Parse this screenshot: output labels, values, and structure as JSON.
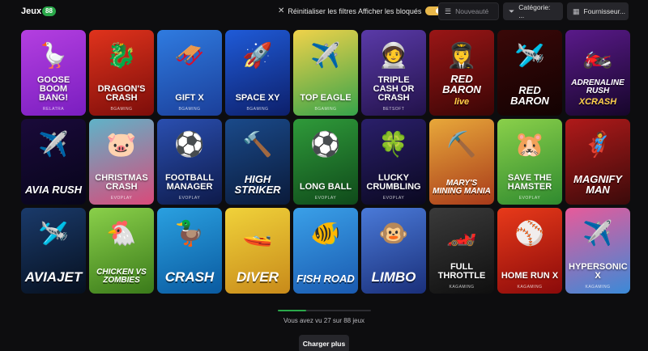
{
  "header": {
    "title": "Jeux",
    "count": "88",
    "reset_label": "Réinitialiser les filtres",
    "blocked_label": "Afficher les bloqués",
    "sort_placeholder": "Nouveauté",
    "category_label": "Catégorie: ...",
    "providers_label": "Fournisseur..."
  },
  "colors": {
    "accent_green": "#2aa84a",
    "toggle_on": "#e8b74a",
    "background": "#0d0d0f"
  },
  "games": [
    {
      "name": "GOOSE BOOM BANG!",
      "provider": "RELATRA",
      "bg": "linear-gradient(160deg,#b43fe0,#7a1ec0)",
      "icon": "🪿"
    },
    {
      "name": "DRAGON'S CRASH",
      "provider": "BGAMING",
      "bg": "linear-gradient(160deg,#e0331c,#7c0d0a)",
      "icon": "🐉"
    },
    {
      "name": "GIFT X",
      "provider": "BGAMING",
      "bg": "linear-gradient(160deg,#2f7be0,#1b3f9a)",
      "icon": "🛷"
    },
    {
      "name": "SPACE XY",
      "provider": "BGAMING",
      "bg": "linear-gradient(160deg,#1f5bd8,#0d1f6a)",
      "icon": "🚀"
    },
    {
      "name": "TOP EAGLE",
      "provider": "BGAMING",
      "bg": "linear-gradient(160deg,#f0d24a,#36a34a)",
      "icon": "✈️"
    },
    {
      "name": "TRIPLE CASH OR CRASH",
      "provider": "BETSOFT",
      "bg": "linear-gradient(160deg,#5a3aa8,#22124a)",
      "icon": "🧑‍🚀"
    },
    {
      "name": "RED BARON",
      "provider": "",
      "bg": "linear-gradient(160deg,#9a1616,#3a0505)",
      "icon": "👩‍✈️",
      "logo": "RED BARON",
      "logo_sub": "live"
    },
    {
      "name": "RED BARON",
      "provider": "",
      "bg": "linear-gradient(160deg,#3a0808,#120202)",
      "icon": "🛩️",
      "logo": "RED BARON"
    },
    {
      "name": "ADRENALINE RUSH XCRASH",
      "provider": "",
      "bg": "linear-gradient(160deg,#5a1a8a,#16062a)",
      "icon": "🏍️",
      "logo": "ADRENALINE RUSH",
      "logo_sub": "XCRASH"
    },
    {
      "name": "AVIA RUSH",
      "provider": "",
      "bg": "linear-gradient(160deg,#1a0a3a,#07051a)",
      "icon": "✈️",
      "logo": "AVIA RUSH"
    },
    {
      "name": "CHRISTMAS CRASH",
      "provider": "EVOPLAY",
      "bg": "linear-gradient(160deg,#5fb3c8,#d94a7a)",
      "icon": "🐷"
    },
    {
      "name": "FOOTBALL MANAGER",
      "provider": "EVOPLAY",
      "bg": "linear-gradient(160deg,#2a4fb0,#0e1a4a)",
      "icon": "⚽"
    },
    {
      "name": "HIGH STRIKER",
      "provider": "",
      "bg": "linear-gradient(160deg,#1a4a8a,#0a1a3a)",
      "icon": "🔨",
      "logo": "HIGH STRIKER"
    },
    {
      "name": "LONG BALL",
      "provider": "EVOPLAY",
      "bg": "linear-gradient(160deg,#2f9a3a,#0f4a1a)",
      "icon": "⚽"
    },
    {
      "name": "LUCKY CRUMBLING",
      "provider": "EVOPLAY",
      "bg": "linear-gradient(160deg,#2a1f6a,#0a0820)",
      "icon": "🍀"
    },
    {
      "name": "MARY'S MINING MANIA",
      "provider": "",
      "bg": "linear-gradient(160deg,#e8a83a,#a83a1a)",
      "icon": "⛏️",
      "logo": "MARY'S MINING MANIA"
    },
    {
      "name": "SAVE THE HAMSTER",
      "provider": "EVOPLAY",
      "bg": "linear-gradient(160deg,#8ad04a,#2f8a2f)",
      "icon": "🐹"
    },
    {
      "name": "MAGNIFY MAN",
      "provider": "",
      "bg": "linear-gradient(160deg,#b01a1a,#3a0a0a)",
      "icon": "🦸",
      "logo": "MAGNIFY MAN"
    },
    {
      "name": "AVIAJET",
      "provider": "",
      "bg": "linear-gradient(160deg,#1a3a6a,#06101f)",
      "icon": "🛩️",
      "logo": "AVIAJET"
    },
    {
      "name": "CHICKEN VS ZOMBIES",
      "provider": "",
      "bg": "linear-gradient(160deg,#8ad04a,#3a7a1a)",
      "icon": "🐔",
      "logo": "CHICKEN VS ZOMBIES"
    },
    {
      "name": "CRASH",
      "provider": "",
      "bg": "linear-gradient(160deg,#2aa0e0,#0a5aa0)",
      "icon": "🦆",
      "logo": "CRASH"
    },
    {
      "name": "DIVER",
      "provider": "",
      "bg": "linear-gradient(160deg,#f0d23a,#c88a1a)",
      "icon": "🚤",
      "logo": "DIVER"
    },
    {
      "name": "FISH ROAD",
      "provider": "",
      "bg": "linear-gradient(160deg,#3aa0e8,#1a5ab0)",
      "icon": "🐠",
      "logo": "FISH ROAD"
    },
    {
      "name": "LIMBO",
      "provider": "",
      "bg": "linear-gradient(160deg,#4a7ad8,#1a2f7a)",
      "icon": "🐵",
      "logo": "LIMBO"
    },
    {
      "name": "FULL THROTTLE",
      "provider": "KAGAMING",
      "bg": "linear-gradient(160deg,#3a3a3a,#0f0f0f)",
      "icon": "🏎️"
    },
    {
      "name": "HOME RUN X",
      "provider": "KAGAMING",
      "bg": "linear-gradient(160deg,#e83a1a,#8a0a0a)",
      "icon": "⚾"
    },
    {
      "name": "HYPERSONIC X",
      "provider": "KAGAMING",
      "bg": "linear-gradient(160deg,#e85a9a,#3a8ad8)",
      "icon": "✈️"
    }
  ],
  "footer": {
    "progress": 0.307,
    "seen_text": "Vous avez vu 27 sur 88 jeux",
    "load_more": "Charger plus"
  }
}
